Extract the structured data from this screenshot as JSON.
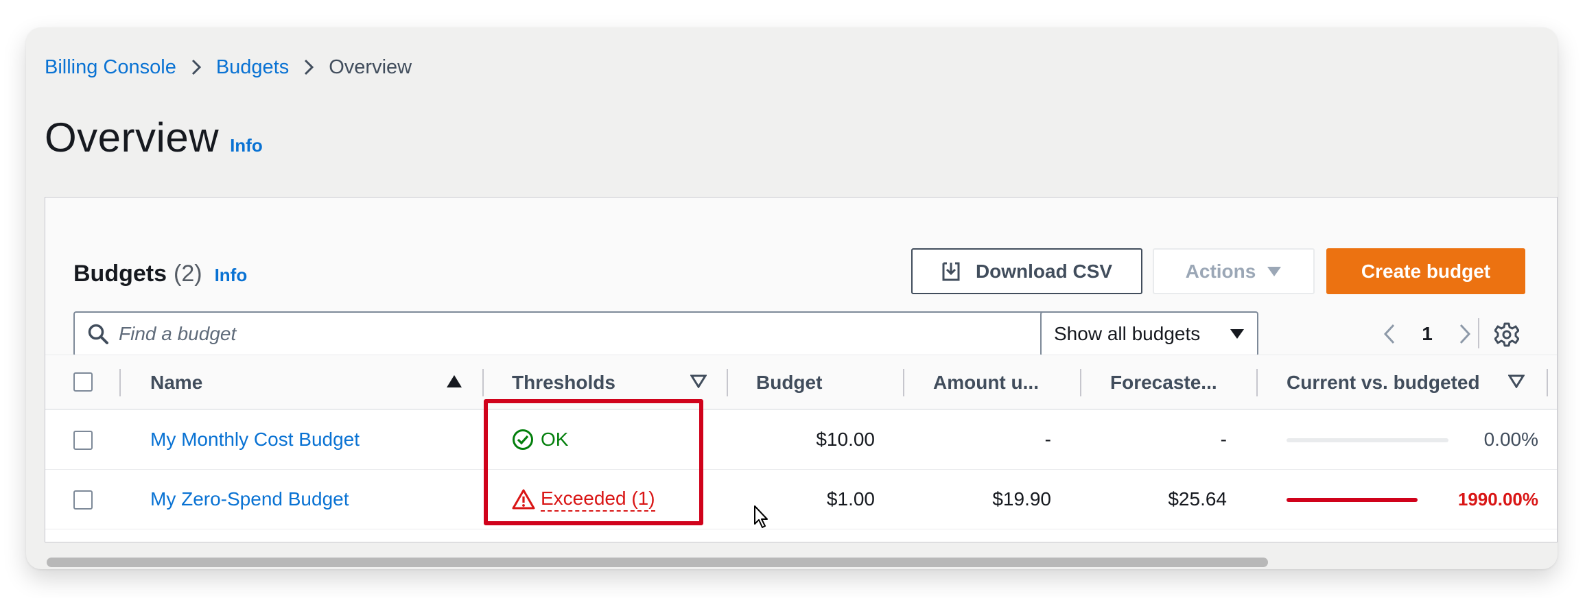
{
  "breadcrumb": {
    "items": [
      "Billing Console",
      "Budgets"
    ],
    "current": "Overview"
  },
  "page": {
    "title": "Overview",
    "info": "Info"
  },
  "panel": {
    "title": "Budgets",
    "count": "(2)",
    "info": "Info",
    "download_label": "Download CSV",
    "actions_label": "Actions",
    "create_label": "Create budget",
    "search_placeholder": "Find a budget",
    "filter_selected": "Show all budgets",
    "current_page": "1"
  },
  "table": {
    "columns": {
      "name": "Name",
      "thresholds": "Thresholds",
      "budget": "Budget",
      "amount_used": "Amount u...",
      "forecasted": "Forecaste...",
      "current_vs_budgeted": "Current vs. budgeted"
    },
    "rows": [
      {
        "name": "My Monthly Cost Budget",
        "threshold_status": "OK",
        "budget": "$10.00",
        "amount_used": "-",
        "forecasted": "-",
        "percent_label": "0.00%",
        "percent_value": 0.0
      },
      {
        "name": "My Zero-Spend Budget",
        "threshold_status": "Exceeded (1)",
        "budget": "$1.00",
        "amount_used": "$19.90",
        "forecasted": "$25.64",
        "percent_label": "1990.00%",
        "percent_value": 1990.0
      }
    ]
  },
  "icons": {
    "chevron": "chevron-right-icon",
    "search": "search-icon",
    "download": "download-icon",
    "settings": "gear-icon",
    "ok": "check-circle-icon",
    "warning": "warning-triangle-icon"
  },
  "colors": {
    "link": "#0972d3",
    "primary_button": "#ec7211",
    "ok": "#037f0c",
    "error": "#d91515",
    "highlight": "#d0021b"
  }
}
